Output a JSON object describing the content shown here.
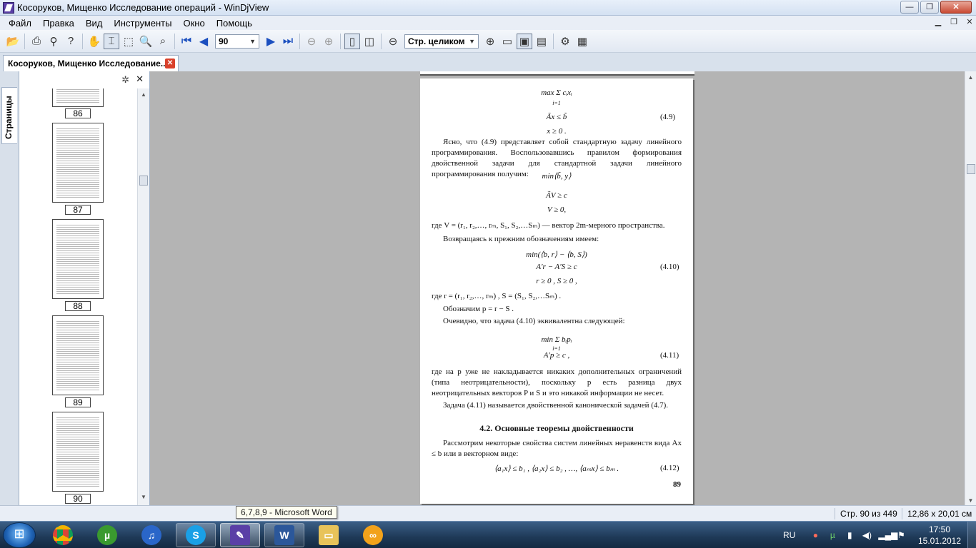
{
  "window": {
    "title": "Косоруков, Мищенко Исследование операций - WinDjView",
    "min": "—",
    "max": "❐",
    "close": "✕"
  },
  "menu": [
    "Файл",
    "Правка",
    "Вид",
    "Инструменты",
    "Окно",
    "Помощь"
  ],
  "toolbar": {
    "page_value": "90",
    "zoom_value": "Стр. целиком"
  },
  "tab": {
    "doc_title": "Косоруков, Мищенко Исследование...",
    "close": "✕"
  },
  "sidebar": {
    "vertical_tab": "Страницы",
    "thumbnails": [
      {
        "label": "86"
      },
      {
        "label": "87"
      },
      {
        "label": "88"
      },
      {
        "label": "89"
      },
      {
        "label": "90"
      }
    ]
  },
  "page": {
    "l01": "max Σ cᵢxᵢ",
    "l02": "i=1",
    "l03": "Ãx ≤ b̃",
    "l03n": "(4.9)",
    "l04": "x ≥ 0 .",
    "p1": "Ясно, что (4.9) представляет собой стандартную задачу линейного программирования. Воспользовавшись правилом формирования двойственной задачи для стандартной задачи линейного программирования получим:",
    "l05": "min⟨b̃, y⟩",
    "l06": "ÃV ≥ c",
    "l07": "V ≥ 0,",
    "p2": "где V = (r₁, r₂,…, rₘ, S₁, S₂,…Sₘ) — вектор 2m-мерного пространства.",
    "p3": "Возвращаясь к прежним обозначениям имеем:",
    "l08": "min(⟨b, r⟩ − ⟨b, S⟩)",
    "l09": "A′r − A′S ≥ c",
    "l09n": "(4.10)",
    "l10": "r ≥ 0 ,  S ≥ 0 ,",
    "p4": "где r = (r₁, r₂,…, rₘ) ,  S = (S₁, S₂,…Sₘ) .",
    "p5": "Обозначим  p = r − S .",
    "p6": "Очевидно, что задача (4.10) эквивалентна следующей:",
    "l11": "min Σ bᵢpᵢ",
    "l12": "i=1",
    "l13": "A′p ≥ c ,",
    "l13n": "(4.11)",
    "p7": "где на p уже не накладывается никаких дополнительных ограничений (типа неотрицательности), поскольку p есть разница двух неотрицательных векторов P и S и это никакой информации не несет.",
    "p8": "Задача (4.11) называется двойственной канонической задачей (4.7).",
    "heading": "4.2. Основные теоремы двойственности",
    "p9": "Рассмотрим некоторые свойства систем линейных неравенств вида Ax ≤ b или в векторном виде:",
    "l14": "⟨a₁x⟩ ≤ b₁ , ⟨a₂x⟩ ≤ b₂ , …, ⟨aₘx⟩ ≤ bₘ .",
    "l14n": "(4.12)",
    "pagenum": "89"
  },
  "status": {
    "page_info": "Стр. 90 из 449",
    "page_size": "12,86 x 20,01 см"
  },
  "tooltip": "6,7,8,9 - Microsoft Word",
  "taskbar": {
    "apps": [
      "chrome",
      "utorrent",
      "itunes",
      "skype",
      "windjview",
      "word",
      "explorer",
      "other"
    ],
    "lang": "RU",
    "time": "17:50",
    "date": "15.01.2012"
  },
  "colors": {
    "accent": "#1b4fbf",
    "close_red": "#c94a33",
    "taskbar": "#1e3957"
  }
}
